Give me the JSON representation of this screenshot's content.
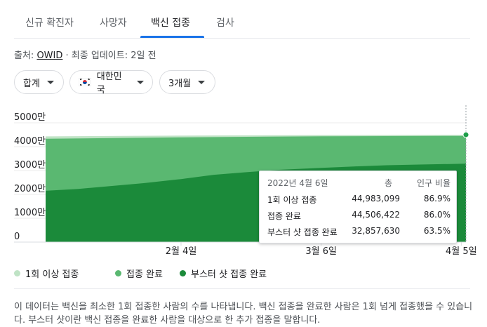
{
  "tabs": [
    {
      "label": "신규 확진자",
      "active": false
    },
    {
      "label": "사망자",
      "active": false
    },
    {
      "label": "백신 접종",
      "active": true
    },
    {
      "label": "검사",
      "active": false
    }
  ],
  "source": {
    "prefix": "출처:",
    "link": "OWID",
    "suffix": "· 최종 업데이트: 2일 전"
  },
  "filters": {
    "aggregate": "합계",
    "country": "대한민국",
    "range": "3개월"
  },
  "colors": {
    "accent": "#1a73e8",
    "series1": "#bfe3c5",
    "series2": "#5ab871",
    "series3": "#1b8a3a"
  },
  "chart_data": {
    "type": "area",
    "y_ticks": [
      "0",
      "1000만",
      "2000만",
      "3000만",
      "4000만",
      "5000만"
    ],
    "ylim": [
      0,
      50000000
    ],
    "x_labels": [
      {
        "label": "2월 4일",
        "date": "2022-02-04"
      },
      {
        "label": "3월 6일",
        "date": "2022-03-06"
      },
      {
        "label": "4월 5일",
        "date": "2022-04-05"
      }
    ],
    "x_range": [
      "2022-01-06",
      "2022-04-06"
    ],
    "series": [
      {
        "name": "1회 이상 접종",
        "color": "#bfe3c5",
        "points": [
          [
            "2022-01-06",
            44300000
          ],
          [
            "2022-02-04",
            44650000
          ],
          [
            "2022-03-06",
            44880000
          ],
          [
            "2022-04-06",
            44983099
          ]
        ]
      },
      {
        "name": "접종 완료",
        "color": "#5ab871",
        "points": [
          [
            "2022-01-06",
            43300000
          ],
          [
            "2022-02-04",
            43900000
          ],
          [
            "2022-03-06",
            44350000
          ],
          [
            "2022-04-06",
            44506422
          ]
        ]
      },
      {
        "name": "부스터 샷 접종 완료",
        "color": "#1b8a3a",
        "points": [
          [
            "2022-01-06",
            21500000
          ],
          [
            "2022-01-13",
            22300000
          ],
          [
            "2022-01-20",
            23500000
          ],
          [
            "2022-01-27",
            24700000
          ],
          [
            "2022-02-04",
            26400000
          ],
          [
            "2022-02-11",
            28200000
          ],
          [
            "2022-02-18",
            29300000
          ],
          [
            "2022-02-25",
            30300000
          ],
          [
            "2022-03-06",
            31100000
          ],
          [
            "2022-03-13",
            31700000
          ],
          [
            "2022-03-20",
            32200000
          ],
          [
            "2022-03-27",
            32500000
          ],
          [
            "2022-04-06",
            32857630
          ]
        ]
      }
    ],
    "tooltip": {
      "date": "2022년 4월 6일",
      "col_total": "총",
      "col_ratio": "인구 비율",
      "rows": [
        {
          "label": "1회 이상 접종",
          "total": "44,983,099",
          "ratio": "86.9%"
        },
        {
          "label": "접종 완료",
          "total": "44,506,422",
          "ratio": "86.0%"
        },
        {
          "label": "부스터 샷 접종 완료",
          "total": "32,857,630",
          "ratio": "63.5%"
        }
      ]
    }
  },
  "legend": [
    {
      "label": "1회 이상 접종",
      "color": "#bfe3c5"
    },
    {
      "label": "접종 완료",
      "color": "#5ab871"
    },
    {
      "label": "부스터 샷 접종 완료",
      "color": "#1b8a3a"
    }
  ],
  "description": "이 데이터는 백신을 최소한 1회 접종한 사람의 수를 나타냅니다. 백신 접종을 완료한 사람은 1회 넘게 접종했을 수 있습니다. 부스터 샷이란 백신 접종을 완료한 사람을 대상으로 한 추가 접종을 말합니다."
}
